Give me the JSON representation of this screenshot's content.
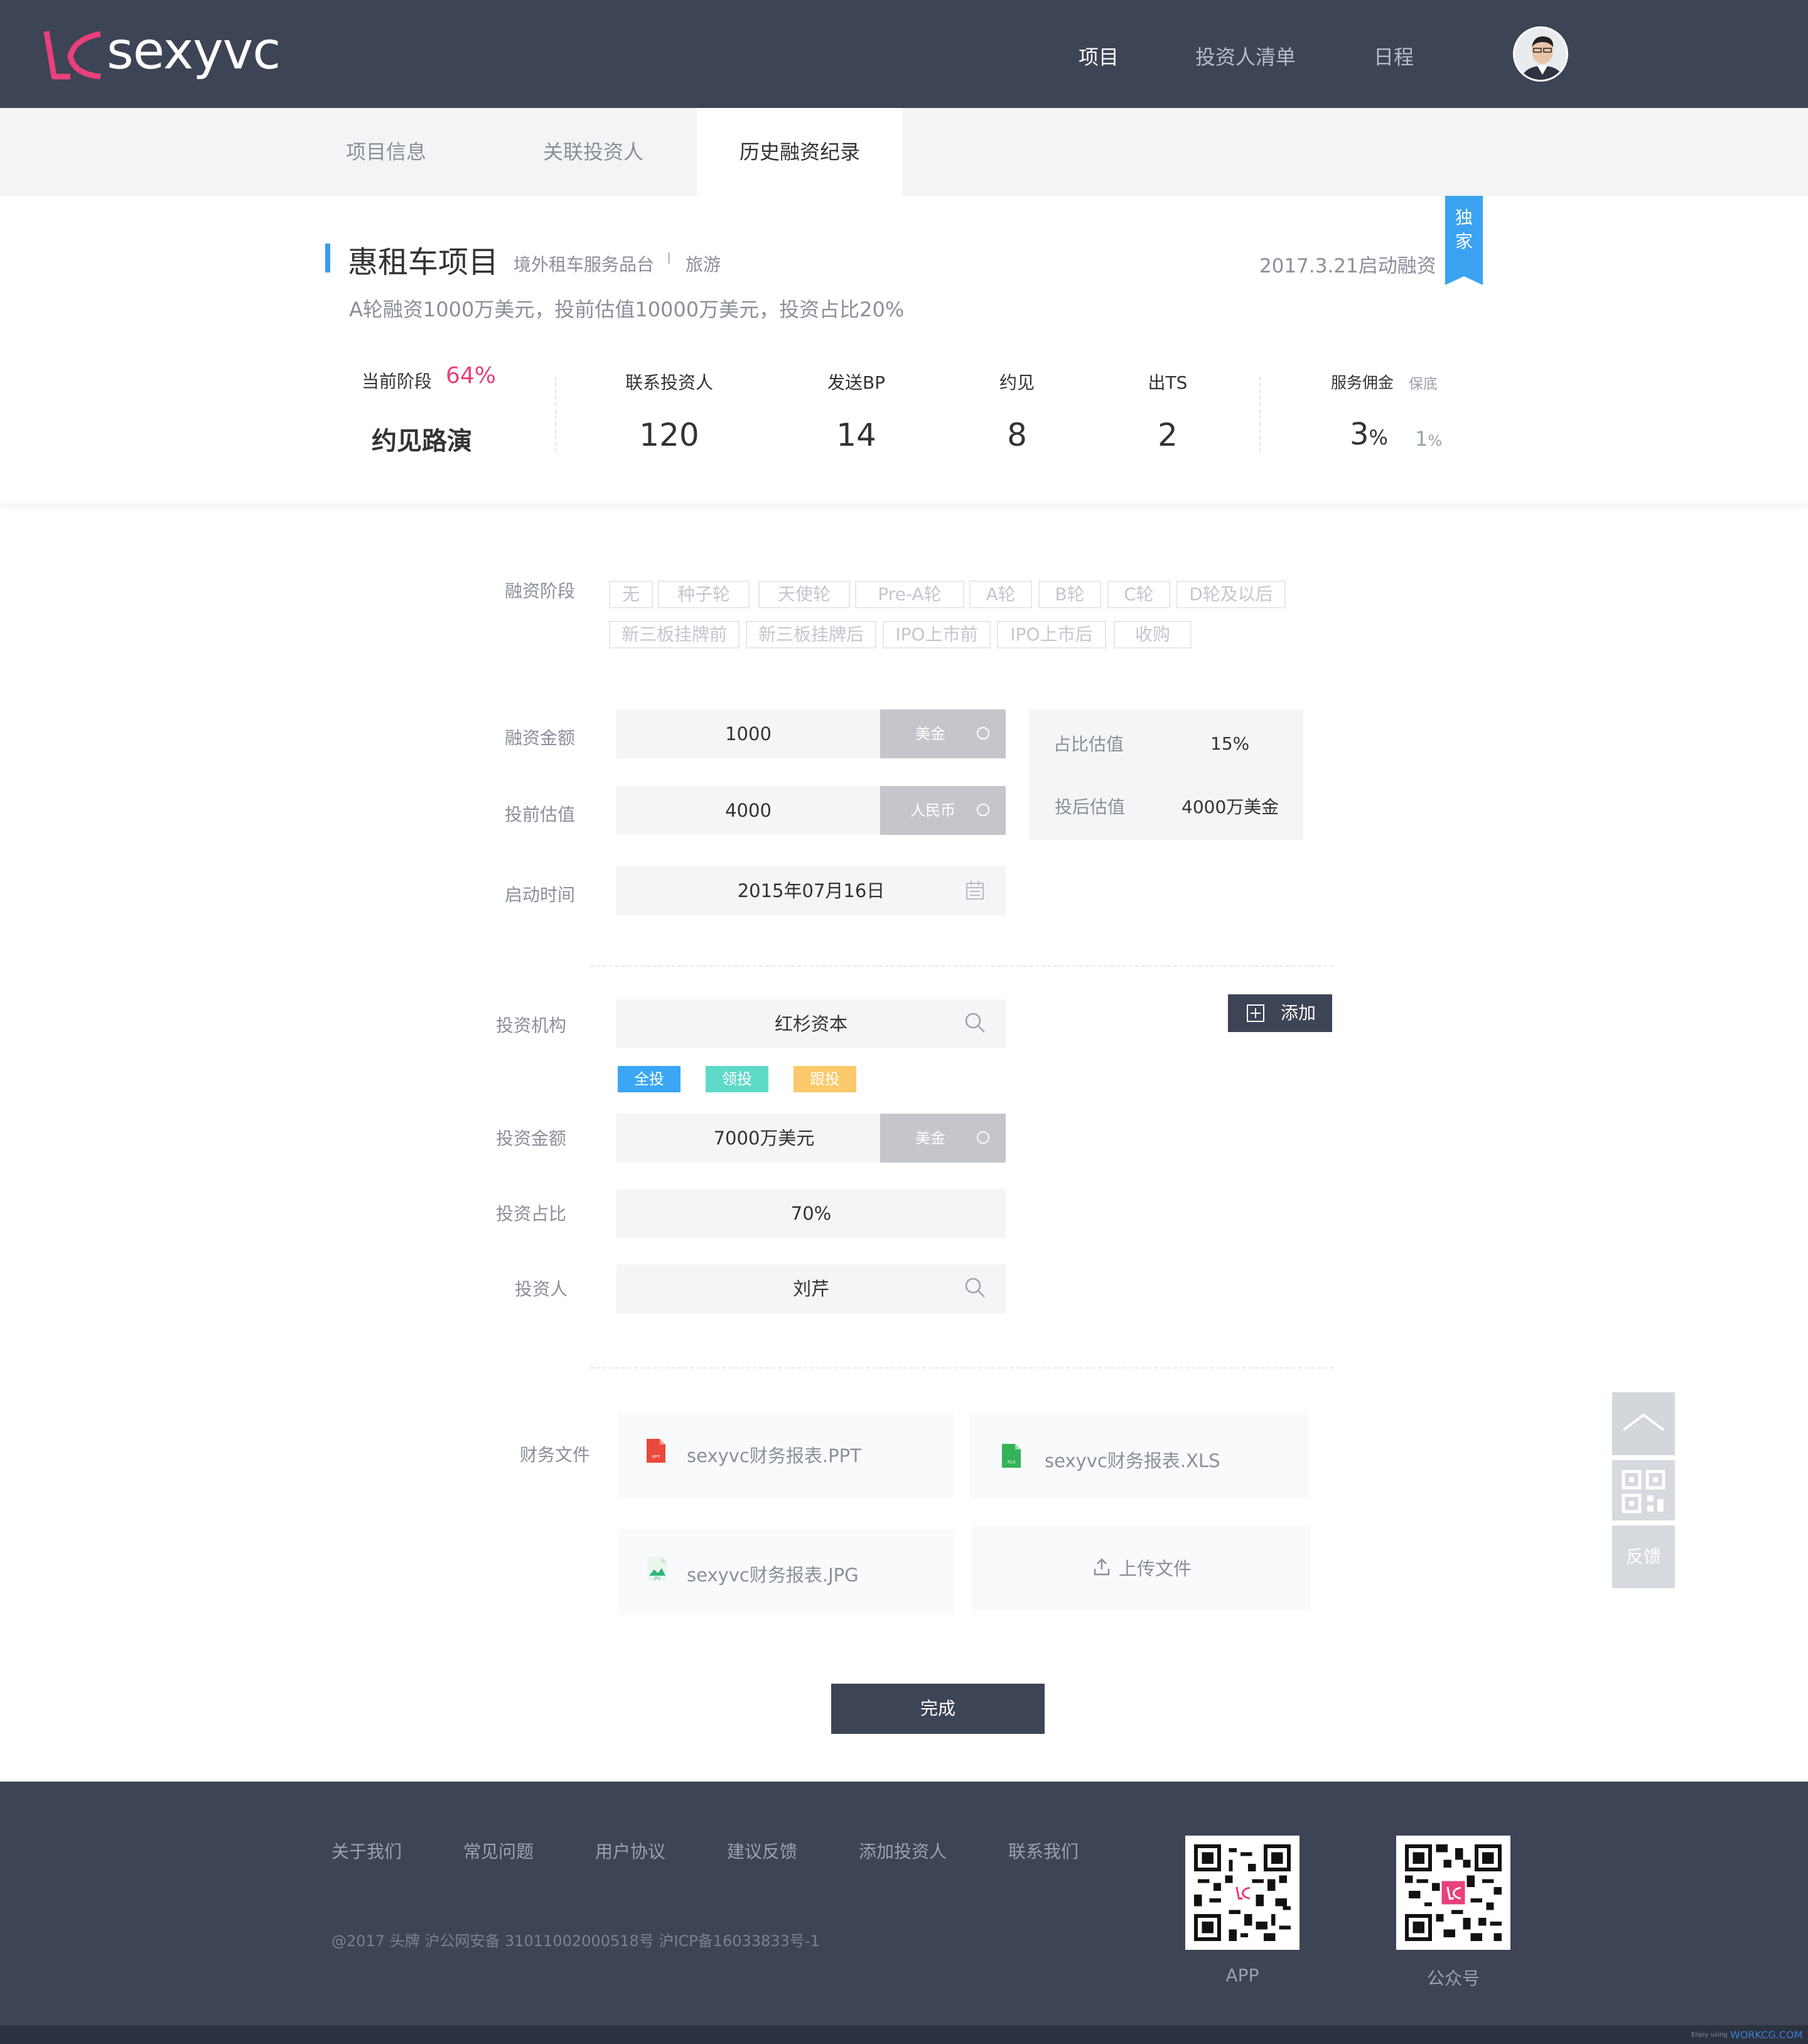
{
  "brand": {
    "name": "sexyvc",
    "accent": "#e8407a"
  },
  "nav": {
    "items": [
      {
        "label": "项目",
        "active": true
      },
      {
        "label": "投资人清单",
        "active": false
      },
      {
        "label": "日程",
        "active": false
      }
    ]
  },
  "tabs": [
    {
      "label": "项目信息",
      "active": false
    },
    {
      "label": "关联投资人",
      "active": false
    },
    {
      "label": "历史融资纪录",
      "active": true
    }
  ],
  "project": {
    "title": "惠租车项目",
    "category": "境外租车服务品台",
    "separator": "I",
    "industry": "旅游",
    "start_date": "2017.3.21启动融资",
    "exclusive_line1": "独",
    "exclusive_line2": "家",
    "summary": "A轮融资1000万美元，投前估值10000万美元，投资占比20%",
    "stage_label": "当前阶段",
    "stage_percent": "64%",
    "stage_value": "约见路演",
    "stats": [
      {
        "label": "联系投资人",
        "value": "120"
      },
      {
        "label": "发送BP",
        "value": "14"
      },
      {
        "label": "约见",
        "value": "8"
      },
      {
        "label": "出TS",
        "value": "2"
      }
    ],
    "commission_label": "服务佣金",
    "guarantee_label": "保底",
    "commission_value": "3",
    "commission_unit": "%",
    "guarantee_value": "1",
    "guarantee_unit": "%"
  },
  "form": {
    "stage_label": "融资阶段",
    "stage_options_row1": [
      "无",
      "种子轮",
      "天使轮",
      "Pre-A轮",
      "A轮",
      "B轮",
      "C轮",
      "D轮及以后"
    ],
    "stage_options_row2": [
      "新三板挂牌前",
      "新三板挂牌后",
      "IPO上市前",
      "IPO上市后",
      "收购"
    ],
    "amount_label": "融资金额",
    "amount_value": "1000",
    "amount_unit": "美金",
    "pre_valuation_label": "投前估值",
    "pre_valuation_value": "4000",
    "pre_valuation_unit": "人民币",
    "start_time_label": "启动时间",
    "start_time_value": "2015年07月16日",
    "ratio_label": "占比估值",
    "ratio_value": "15%",
    "post_valuation_label": "投后估值",
    "post_valuation_value": "4000万美金",
    "institution_label": "投资机构",
    "institution_value": "红杉资本",
    "add_label": "添加",
    "chips": [
      {
        "label": "全投",
        "color": "#3aa6f5"
      },
      {
        "label": "领投",
        "color": "#5fdac8"
      },
      {
        "label": "跟投",
        "color": "#fbc969"
      }
    ],
    "invest_amount_label": "投资金额",
    "invest_amount_value": "7000万美元",
    "invest_amount_unit": "美金",
    "invest_ratio_label": "投资占比",
    "invest_ratio_value": "70%",
    "investor_label": "投资人",
    "investor_value": "刘芹",
    "files_label": "财务文件",
    "files": [
      {
        "name": "sexyvc财务报表.PPT",
        "icon_text": "PPT",
        "color": "#e8493a"
      },
      {
        "name": "sexyvc财务报表.XLS",
        "icon_text": "XLS",
        "color": "#33b35a"
      },
      {
        "name": "sexyvc财务报表.JPG",
        "icon_text": "JPG",
        "color": "#2fb57a"
      }
    ],
    "upload_label": "上传文件",
    "submit_label": "完成"
  },
  "side": {
    "feedback_label": "反馈"
  },
  "footer": {
    "links": [
      "关于我们",
      "常见问题",
      "用户协议",
      "建议反馈",
      "添加投资人",
      "联系我们"
    ],
    "copyright": "@2017 头牌  沪公网安备 31011002000518号 沪ICP备16033833号-1",
    "qr_app_label": "APP",
    "qr_wechat_label": "公众号"
  },
  "watermark": {
    "prefix": "Enjoy using",
    "site": "WORKCG.COM"
  }
}
